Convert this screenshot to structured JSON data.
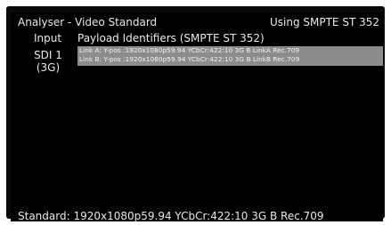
{
  "header": {
    "title": "Analyser - Video Standard",
    "status": "Using SMPTE ST 352"
  },
  "columns": {
    "input_label": "Input",
    "payload_label": "Payload Identifiers (SMPTE ST 352)"
  },
  "input": {
    "name": "SDI 1",
    "rate": "(3G)"
  },
  "payload_identifiers": [
    "Link A: Y-pos :1920x1080p59.94 YCbCr:422:10 3G B LinkA Rec.709",
    "Link B: Y-pos :1920x1080p59.94 YCbCr:422:10 3G B LinkB Rec.709"
  ],
  "footer": {
    "standard": "Standard: 1920x1080p59.94 YCbCr:422:10 3G B Rec.709"
  },
  "colors": {
    "background": "#000000",
    "text": "#e8e8e8",
    "selection": "#8c8c8c"
  }
}
